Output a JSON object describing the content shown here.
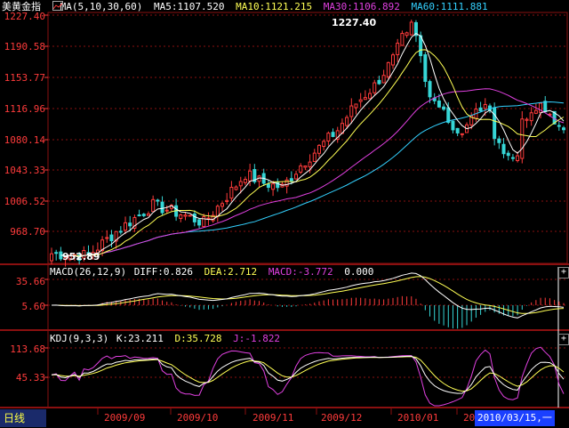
{
  "colors": {
    "up": "#ff3b3b",
    "down": "#36d6d6",
    "ma5": "#ffffff",
    "ma10": "#ffff55",
    "ma30": "#e040e0",
    "ma60": "#33d1ff",
    "grid": "#8a1010",
    "axis_text": "#ff3b3b"
  },
  "header": {
    "title": "美黄金指",
    "ma_icon": "ma-indicator-icon",
    "ma_params": "MA(5,10,30,60)",
    "ma5": "MA5:1107.520",
    "ma10": "MA10:1121.215",
    "ma30": "MA30:1106.892",
    "ma60": "MA60:1111.881"
  },
  "macd_legend": {
    "params": "MACD(26,12,9)",
    "diff": "DIFF:0.826",
    "dea": "DEA:2.712",
    "macd": "MACD:-3.772",
    "zero": "0.000"
  },
  "kdj_legend": {
    "params": "KDJ(9,3,3)",
    "k": "K:23.211",
    "d": "D:35.728",
    "j": "J:-1.822"
  },
  "price_axis": [
    "1227.40",
    "1190.58",
    "1153.77",
    "1116.96",
    "1080.14",
    "1043.33",
    "1006.52",
    "968.70"
  ],
  "macd_axis": [
    "35.66",
    "5.60"
  ],
  "kdj_axis": [
    "113.68",
    "45.33"
  ],
  "annotations": {
    "high": "1227.40",
    "low": "952.89"
  },
  "x_axis": [
    "2009/09",
    "2009/10",
    "2009/11",
    "2009/12",
    "2010/01",
    "20"
  ],
  "period_tab": "日线",
  "date_cursor": "2010/03/15,一",
  "plus_icon": "+"
}
